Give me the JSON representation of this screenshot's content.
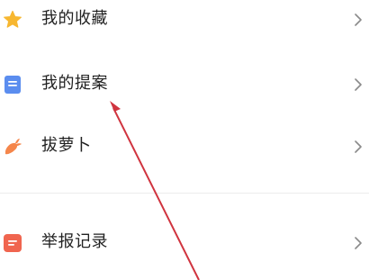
{
  "menu": {
    "items": [
      {
        "label": "我的收藏",
        "icon": "star-icon",
        "icon_color": "#F7B731"
      },
      {
        "label": "我的提案",
        "icon": "document-icon",
        "icon_color": "#5B8DEF"
      },
      {
        "label": "拔萝卜",
        "icon": "carrot-icon",
        "icon_color": "#F5864B"
      },
      {
        "label": "举报记录",
        "icon": "report-icon",
        "icon_color": "#F0654F"
      }
    ],
    "chevron": ">"
  },
  "colors": {
    "text": "#222222",
    "chevron": "#8a8a8a",
    "divider": "#ececec",
    "annotation_arrow": "#D0343F"
  }
}
